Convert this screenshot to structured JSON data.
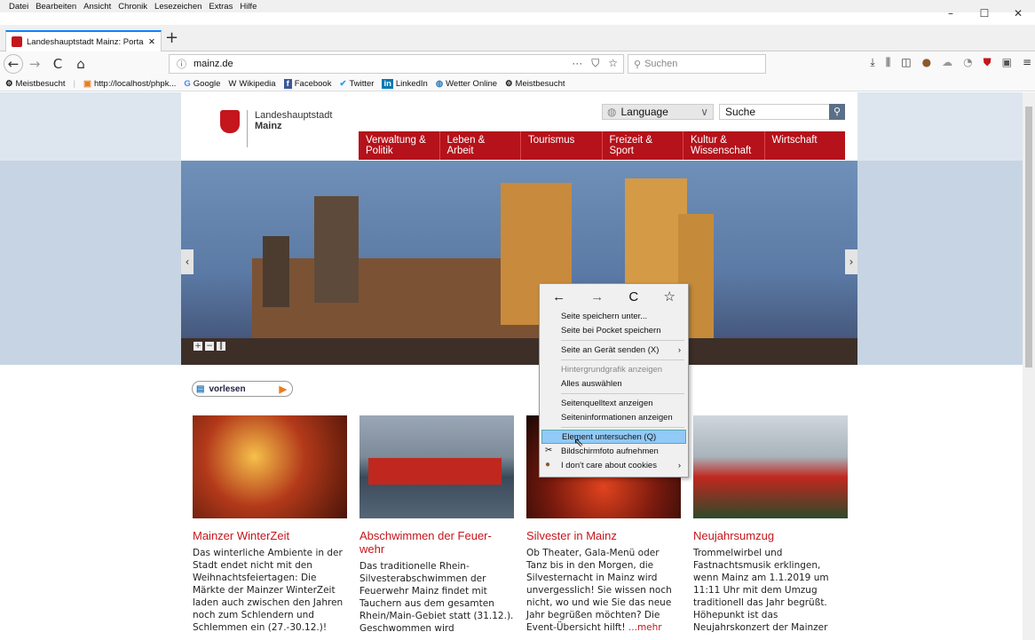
{
  "menubar": [
    "Datei",
    "Bearbeiten",
    "Ansicht",
    "Chronik",
    "Lesezeichen",
    "Extras",
    "Hilfe"
  ],
  "window_controls": {
    "minimize": "–",
    "maximize": "☐",
    "close": "✕"
  },
  "tab": {
    "title": "Landeshauptstadt Mainz: Portal",
    "close": "✕",
    "new_tab": "+"
  },
  "nav": {
    "back": "←",
    "forward": "→",
    "reload": "C",
    "home": "⌂",
    "url": "mainz.de",
    "more": "···",
    "search_placeholder": "Suchen"
  },
  "bookmarks": [
    {
      "label": "Meistbesucht",
      "icon": "gear-icon"
    },
    {
      "label": "http://localhost/phpk...",
      "icon": "php-icon"
    },
    {
      "label": "Google",
      "icon": "google-icon"
    },
    {
      "label": "Wikipedia",
      "icon": "wikipedia-icon"
    },
    {
      "label": "Facebook",
      "icon": "facebook-icon"
    },
    {
      "label": "Twitter",
      "icon": "twitter-icon"
    },
    {
      "label": "LinkedIn",
      "icon": "linkedin-icon"
    },
    {
      "label": "Wetter Online",
      "icon": "globe-icon"
    },
    {
      "label": "Meistbesucht",
      "icon": "gear-icon"
    }
  ],
  "site": {
    "logo_line1": "Landeshauptstadt",
    "logo_line2": "Mainz",
    "language_label": "Language",
    "search_placeholder": "Suche",
    "nav": [
      "Verwaltung & Politik",
      "Leben & Arbeit",
      "Tourismus",
      "Freizeit & Sport",
      "Kultur & Wissenschaft",
      "Wirtschaft"
    ],
    "read_button": "vorlesen",
    "cards": [
      {
        "title": "Mainzer WinterZeit",
        "text": "Das winterliche Ambiente in der Stadt endet nicht mit den Weihnachtsfeiertagen: Die Märkte der Mainzer WinterZeit laden auch zwischen den Jahren noch zum Schlendern und Schlemmen ein (27.-30.12.)!",
        "more": ""
      },
      {
        "title": "Abschwimmen der Feuer-wehr",
        "text": "Das traditionelle Rhein-Silvesterabschwimmen der Feuerwehr Mainz findet mit Tauchern aus dem gesamten Rhein/Main-Gebiet statt (31.12.). Geschwommen wird",
        "more": ""
      },
      {
        "title": "Silvester in Mainz",
        "text": "Ob Theater, Gala-Menü oder Tanz bis in den Morgen, die Silvesternacht in Mainz wird unvergesslich! Sie wissen noch nicht, wo und wie Sie das neue Jahr begrüßen möchten? Die Event-Übersicht hilft!",
        "more": "...mehr"
      },
      {
        "title": "Neujahrsumzug",
        "text": "Trommelwirbel und Fastnachtsmusik erklingen, wenn Mainz am 1.1.2019 um 11:11 Uhr mit dem Umzug traditionell das Jahr begrüßt. Höhepunkt ist das Neujahrskonzert der Mainzer",
        "more": ""
      }
    ]
  },
  "context_menu": {
    "nav": [
      "←",
      "→",
      "C",
      "☆"
    ],
    "items": [
      {
        "label": "Seite speichern unter...",
        "disabled": false,
        "submenu": false
      },
      {
        "label": "Seite bei Pocket speichern",
        "disabled": false,
        "submenu": false
      },
      {
        "sep": true
      },
      {
        "label": "Seite an Gerät senden (X)",
        "disabled": false,
        "submenu": true
      },
      {
        "sep": true
      },
      {
        "label": "Hintergrundgrafik anzeigen",
        "disabled": true,
        "submenu": false
      },
      {
        "label": "Alles auswählen",
        "disabled": false,
        "submenu": false
      },
      {
        "sep": true
      },
      {
        "label": "Seitenquelltext anzeigen",
        "disabled": false,
        "submenu": false
      },
      {
        "label": "Seiteninformationen anzeigen",
        "disabled": false,
        "submenu": false
      },
      {
        "sep": true
      },
      {
        "label": "Element untersuchen (Q)",
        "disabled": false,
        "submenu": false,
        "highlighted": true
      },
      {
        "label": "Bildschirmfoto aufnehmen",
        "disabled": false,
        "submenu": false,
        "icon": "scissors-icon"
      },
      {
        "label": "I don't care about cookies",
        "disabled": false,
        "submenu": true,
        "icon": "cookie-icon"
      }
    ]
  },
  "colors": {
    "brand_red": "#b5121b",
    "link_red": "#c4161c",
    "highlight": "#91c9f7"
  }
}
